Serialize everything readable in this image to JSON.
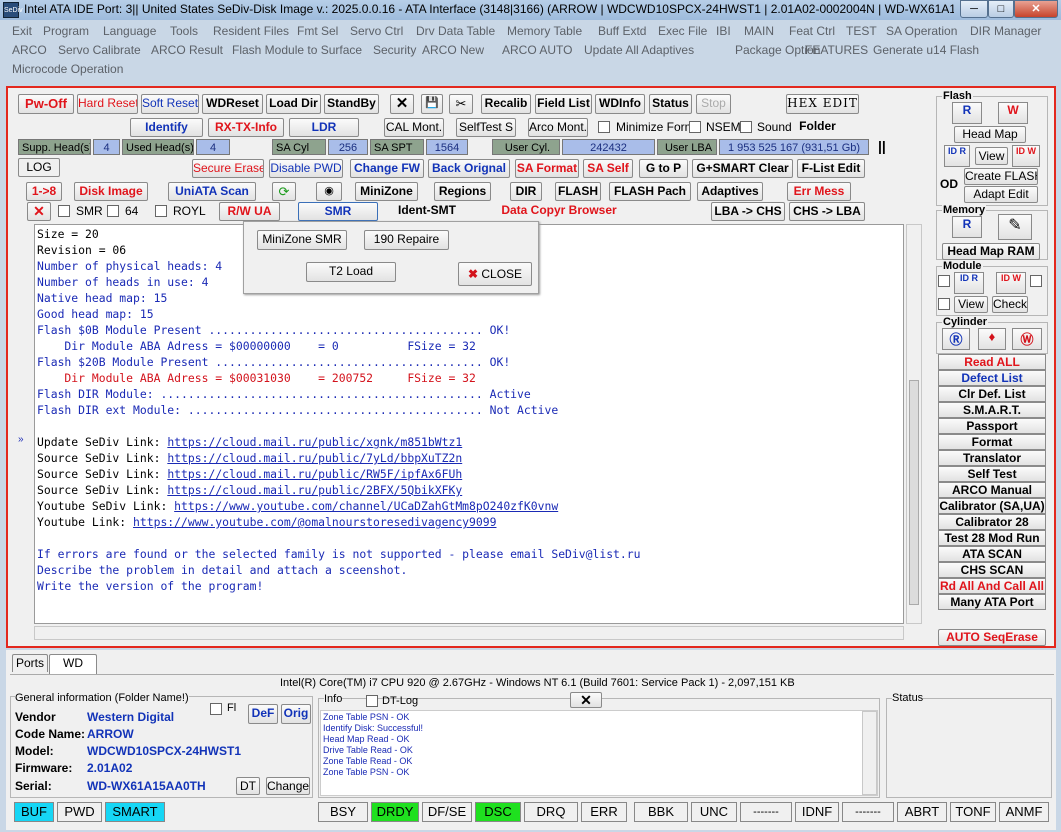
{
  "titlebar": {
    "icon": "SeDiv",
    "title": "Intel ATA IDE  Port: 3|| United States  SeDiv-Disk Image v.: 2025.0.0.16 - ATA Interface (3148|3166)  (ARROW | WDCWD10SPCX-24HWST1 | 2.01A02-0002004N | WD-WX61A1...",
    "min": "─",
    "max": "□",
    "close": "✕"
  },
  "menu": {
    "row1": [
      "Exit",
      "Program",
      "Language",
      "Tools",
      "Resident Files",
      "Fmt Sel",
      "Servo Ctrl",
      "Drv Data Table",
      "Memory Table",
      "Buff Extd",
      "Exec File",
      "IBI",
      "MAIN",
      "Feat Ctrl",
      "TEST",
      "SA Operation",
      "DIR Manager"
    ],
    "row2": [
      "ARCO",
      "Servo Calibrate",
      "ARCO Result",
      "Flash Module to Surface",
      "Security",
      "ARCO New",
      "ARCO AUTO",
      "Update All Adaptives",
      "Package Option",
      "FEATURES",
      "Generate u14 Flash"
    ],
    "row3": [
      "Microcode Operation"
    ]
  },
  "toolbar1": {
    "pwoff": "Pw-Off",
    "hard": "Hard Reset",
    "soft": "Soft Reset",
    "wdreset": "WDReset",
    "loaddir": "Load Dir",
    "standby": "StandBy",
    "close": "✕",
    "save": "💾",
    "tools": "✂",
    "recalib": "Recalib",
    "fieldlist": "Field List",
    "wdinfo": "WDInfo",
    "status": "Status",
    "stop": "Stop",
    "hexedit": "HEX EDIT"
  },
  "toolbar2": {
    "identify": "Identify",
    "rxtx": "RX-TX-Info",
    "ldr": "LDR",
    "calmont": "CAL Mont.",
    "selftest": "SelfTest S",
    "arcomont": "Arco Mont.",
    "minform": "Minimize Form",
    "nsem": "NSEM",
    "sound": "Sound",
    "folder": "Folder"
  },
  "fields": {
    "supp_lbl": "Supp. Head(s)",
    "supp_val": "4",
    "used_lbl": "Used Head(s)",
    "used_val": "4",
    "sacyl_lbl": "SA Cyl",
    "sacyl_val": "256",
    "saspt_lbl": "SA SPT",
    "saspt_val": "1564",
    "ucyl_lbl": "User Cyl.",
    "ucyl_val": "242432",
    "ulba_lbl": "User LBA",
    "ulba_val": "1 953 525 167  (931,51 Gb)"
  },
  "toolbar3": {
    "log": "LOG",
    "secure": "Secure Erase",
    "dispwd": "Disable PWD",
    "changefw": "Change FW",
    "backorig": "Back Orignal",
    "saformat": "SA Format",
    "saself": "SA Self",
    "gtop": "G to P",
    "gsmart": "G+SMART Clear",
    "flist": "F-List Edit"
  },
  "toolbar4": {
    "r18": "1->8",
    "diskimage": "Disk Image",
    "uniata": "UniATA Scan",
    "minizone": "MiniZone",
    "regions": "Regions",
    "dir": "DIR",
    "flash": "FLASH",
    "flashpach": "FLASH Pach",
    "adaptives": "Adaptives",
    "errmess": "Err Mess"
  },
  "toolbar5": {
    "smr": "SMR",
    "s64": "64",
    "royl": "ROYL",
    "rwua": "R/W UA",
    "smrbtn": "SMR",
    "identsmt": "Ident-SMT",
    "datacopyr": "Data Copyr Browser",
    "lbachs": "LBA -> CHS",
    "chslba": "CHS -> LBA"
  },
  "popup": {
    "minizone_smr": "MiniZone SMR",
    "repaire": "190 Repaire",
    "t2load": "T2 Load",
    "close": "CLOSE"
  },
  "console": [
    {
      "t": "Size = 20",
      "c": "ck"
    },
    {
      "t": "Revision = 06",
      "c": "ck"
    },
    {
      "t": "Number of physical heads: 4",
      "c": "cb"
    },
    {
      "t": "Number of heads in use: 4",
      "c": "cb"
    },
    {
      "t": "Native head map: 15",
      "c": "cb"
    },
    {
      "t": "Good head map: 15",
      "c": "cb"
    },
    {
      "t": "Flash $0B Module Present ........................................ OK!",
      "c": "cb"
    },
    {
      "t": "    Dir Module ABA Adress = $00000000    = 0          FSize = 32",
      "c": "cb"
    },
    {
      "t": "Flash $20B Module Present ....................................... OK!",
      "c": "cb"
    },
    {
      "t": "    Dir Module ABA Adress = $00031030    = 200752     FSize = 32",
      "c": "cr"
    },
    {
      "t": "Flash DIR Module: ............................................... Active",
      "c": "cb"
    },
    {
      "t": "Flash DIR ext Module: ........................................... Not Active",
      "c": "cb"
    },
    {
      "t": "",
      "c": "ck"
    },
    {
      "t": "Update SeDiv Link: ",
      "c": "ck",
      "l": "https://cloud.mail.ru/public/xgnk/m851bWtz1"
    },
    {
      "t": "Source SeDiv Link: ",
      "c": "ck",
      "l": "https://cloud.mail.ru/public/7yLd/bbpXuTZ2n"
    },
    {
      "t": "Source SeDiv Link: ",
      "c": "ck",
      "l": "https://cloud.mail.ru/public/RW5F/ipfAx6FUh"
    },
    {
      "t": "Source SeDiv Link: ",
      "c": "ck",
      "l": "https://cloud.mail.ru/public/2BFX/5QbikXFKy"
    },
    {
      "t": "Youtube SeDiv Link: ",
      "c": "ck",
      "l": "https://www.youtube.com/channel/UCaDZahGtMm8pO240zfK0vnw"
    },
    {
      "t": "Youtube Link: ",
      "c": "ck",
      "l": "https://www.youtube.com/@omalnourstoresedivagency9099"
    },
    {
      "t": "",
      "c": "ck"
    },
    {
      "t": "If errors are found or the selected family is not supported - please email SeDiv@list.ru",
      "c": "cb"
    },
    {
      "t": "Describe the problem in detail and attach a sceenshot.",
      "c": "cb"
    },
    {
      "t": "Write the version of the program!",
      "c": "cb"
    }
  ],
  "right": {
    "flash": "Flash",
    "headmap": "Head Map",
    "view": "View",
    "od": "OD",
    "createflash": "Create FLASH",
    "adaptedit": "Adapt Edit",
    "memory": "Memory",
    "headmapram": "Head Map RAM",
    "module": "Module",
    "view2": "View",
    "check": "Check",
    "cylinder": "Cylinder",
    "list": [
      "Read ALL",
      "Defect List",
      "Clr Def. List",
      "S.M.A.R.T.",
      "Passport",
      "Format",
      "Translator",
      "Self Test",
      "ARCO Manual",
      "Calibrator (SA,UA)",
      "Calibrator 28",
      "Test 28 Mod Run",
      "ATA SCAN",
      "CHS SCAN",
      "Rd All And Call All",
      "Many ATA Port"
    ],
    "autoseq": "AUTO SeqErase"
  },
  "tabs": {
    "ports": "Ports",
    "wd": "WD"
  },
  "cpu": "Intel(R) Core(TM) i7 CPU 920  @ 2.67GHz - Windows NT 6.1 (Build 7601: Service Pack 1) -  2,097,151 KB",
  "general": {
    "title": "General information (Folder Name!)",
    "fl": "Fl",
    "def": "DeF",
    "orig": "Orig",
    "vendor_l": "Vendor",
    "vendor": "Western Digital",
    "code_l": "Code Name:",
    "code": "ARROW",
    "model_l": "Model:",
    "model": "WDCWD10SPCX-24HWST1",
    "fw_l": "Firmware:",
    "fw": "2.01A02",
    "serial_l": "Serial:",
    "serial": "WD-WX61A15AA0TH",
    "dt": "DT",
    "change": "Change"
  },
  "info": {
    "title": "Info",
    "dtlog": "DT-Log",
    "lines": [
      "Zone Table PSN - OK",
      "Identify Disk: Successful!",
      "Head Map Read - OK",
      "Drive Table Read - OK",
      "Zone Table Read - OK",
      "Zone Table PSN - OK"
    ]
  },
  "statusbox": "Status",
  "bar": {
    "buf": "BUF",
    "pwd": "PWD",
    "smart": "SMART",
    "bsy": "BSY",
    "drdy": "DRDY",
    "dfse": "DF/SE",
    "dsc": "DSC",
    "drq": "DRQ",
    "err": "ERR",
    "bbk": "BBK",
    "unc": "UNC",
    "d1": "-------",
    "idnf": "IDNF",
    "d2": "-------",
    "abrt": "ABRT",
    "tonf": "TONF",
    "anmf": "ANMF"
  },
  "colors": {
    "cyan": "#16d6f5",
    "green": "#1fe01f",
    "red": "#e3281e"
  }
}
